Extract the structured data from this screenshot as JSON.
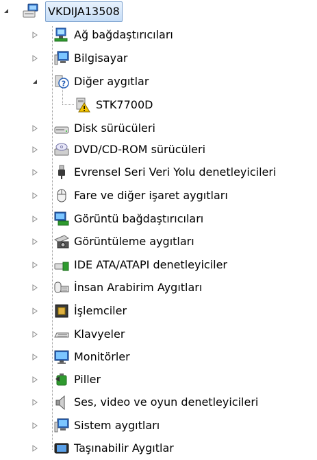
{
  "root": {
    "label": "VKDIJA13508",
    "icon": "computer-icon",
    "expanded": true
  },
  "categories": [
    {
      "label": "Ağ bağdaştırıcıları",
      "icon": "network-adapter-icon",
      "expanded": false
    },
    {
      "label": "Bilgisayar",
      "icon": "computer-monitor-icon",
      "expanded": false
    },
    {
      "label": "Diğer aygıtlar",
      "icon": "unknown-device-icon",
      "expanded": true,
      "children": [
        {
          "label": "STK7700D",
          "icon": "warning-device-icon"
        }
      ]
    },
    {
      "label": "Disk sürücüleri",
      "icon": "disk-drive-icon",
      "expanded": false
    },
    {
      "label": "DVD/CD-ROM sürücüleri",
      "icon": "dvd-drive-icon",
      "expanded": false
    },
    {
      "label": "Evrensel Seri Veri Yolu denetleyicileri",
      "icon": "usb-plug-icon",
      "expanded": false
    },
    {
      "label": "Fare ve diğer işaret aygıtları",
      "icon": "mouse-icon",
      "expanded": false
    },
    {
      "label": "Görüntü bağdaştırıcıları",
      "icon": "display-adapter-icon",
      "expanded": false
    },
    {
      "label": "Görüntüleme aygıtları",
      "icon": "camera-icon",
      "expanded": false
    },
    {
      "label": "IDE ATA/ATAPI denetleyiciler",
      "icon": "ide-controller-icon",
      "expanded": false
    },
    {
      "label": "İnsan Arabirim Aygıtları",
      "icon": "hid-icon",
      "expanded": false
    },
    {
      "label": "İşlemciler",
      "icon": "processor-icon",
      "expanded": false
    },
    {
      "label": "Klavyeler",
      "icon": "keyboard-icon",
      "expanded": false
    },
    {
      "label": "Monitörler",
      "icon": "monitor-icon",
      "expanded": false
    },
    {
      "label": "Piller",
      "icon": "battery-icon",
      "expanded": false
    },
    {
      "label": "Ses, video ve oyun denetleyicileri",
      "icon": "speaker-icon",
      "expanded": false
    },
    {
      "label": "Sistem aygıtları",
      "icon": "system-device-icon",
      "expanded": false
    },
    {
      "label": "Taşınabilir Aygıtlar",
      "icon": "portable-device-icon",
      "expanded": false
    }
  ],
  "colors": {
    "selection_border": "#7da2ce",
    "warning": "#f5c400",
    "tree_line": "#9a9a9a"
  }
}
